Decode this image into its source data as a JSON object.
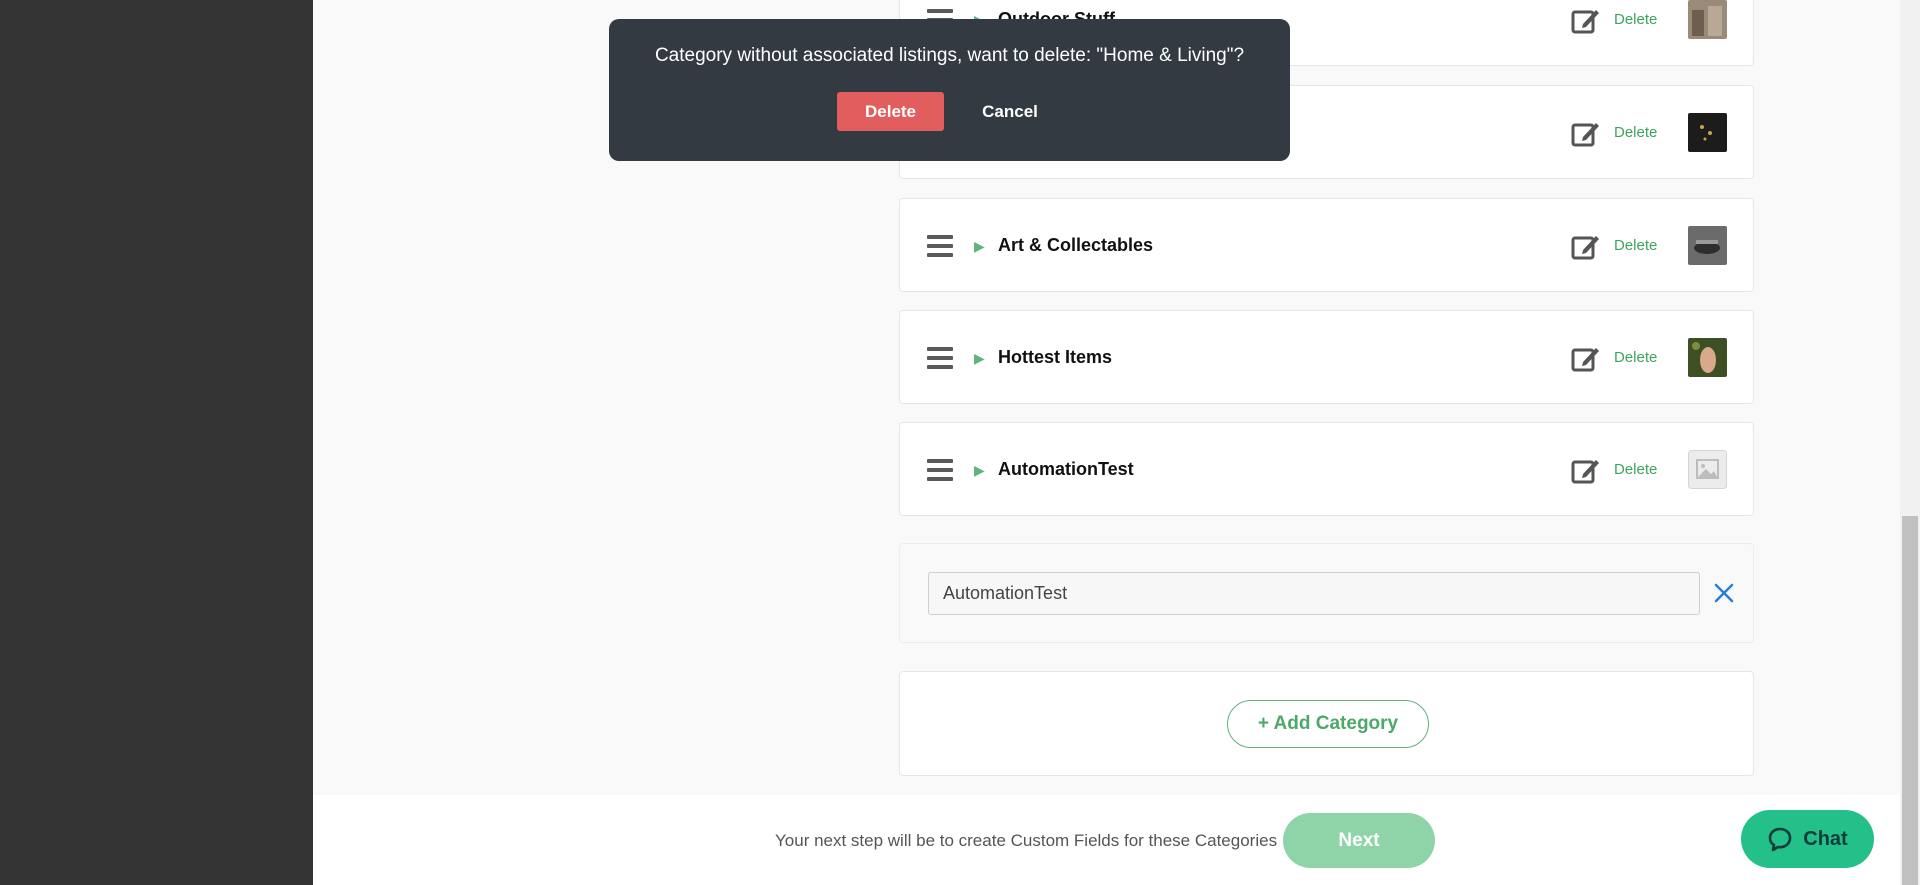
{
  "categories": [
    {
      "name": "Outdoor Stuff",
      "delete_label": "Delete",
      "thumb_color": "#8b7a6a"
    },
    {
      "name": "",
      "delete_label": "Delete",
      "thumb_color": "#1e1e1e"
    },
    {
      "name": "Art & Collectables",
      "delete_label": "Delete",
      "thumb_color": "#5a5a5a"
    },
    {
      "name": "Hottest Items",
      "delete_label": "Delete",
      "thumb_color": "#4a5b2d"
    },
    {
      "name": "AutomationTest",
      "delete_label": "Delete",
      "thumb_color": "#e6e6e6"
    }
  ],
  "edit_row": {
    "input_value": "AutomationTest"
  },
  "add_category_label": "+ Add Category",
  "footer": {
    "hint": "Your next step will be to create Custom Fields for these Categories",
    "next_label": "Next"
  },
  "chat_label": "Chat",
  "dialog": {
    "message": "Category without associated listings, want to delete: \"Home & Living\"?",
    "delete_label": "Delete",
    "cancel_label": "Cancel"
  },
  "colors": {
    "accent_green": "#5fb37b",
    "danger_red": "#e25d5d",
    "dialog_bg": "#333a41",
    "chat_green": "#23c089"
  }
}
